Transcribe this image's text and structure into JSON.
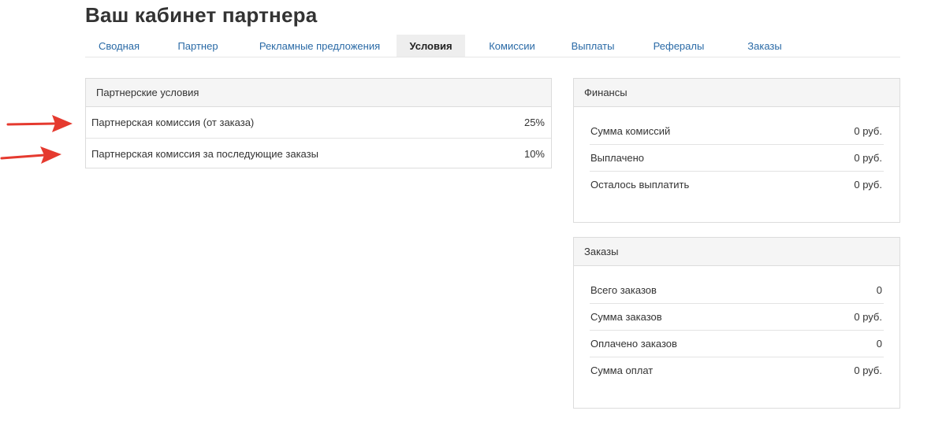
{
  "page": {
    "title": "Ваш кабинет партнера"
  },
  "tabs": [
    {
      "label": "Сводная",
      "active": false
    },
    {
      "label": "Партнер",
      "active": false
    },
    {
      "label": "Рекламные предложения",
      "active": false
    },
    {
      "label": "Условия",
      "active": true
    },
    {
      "label": "Комиссии",
      "active": false
    },
    {
      "label": "Выплаты",
      "active": false
    },
    {
      "label": "Рефералы",
      "active": false
    },
    {
      "label": "Заказы",
      "active": false
    }
  ],
  "conditions": {
    "title": "Партнерские условия",
    "rows": [
      {
        "label": "Партнерская комиссия (от заказа)",
        "value": "25%"
      },
      {
        "label": "Партнерская комиссия за последующие заказы",
        "value": "10%"
      }
    ]
  },
  "finance": {
    "title": "Финансы",
    "rows": [
      {
        "label": "Сумма комиссий",
        "value": "0 руб."
      },
      {
        "label": "Выплачено",
        "value": "0 руб."
      },
      {
        "label": "Осталось выплатить",
        "value": "0 руб."
      }
    ]
  },
  "orders": {
    "title": "Заказы",
    "rows": [
      {
        "label": "Всего заказов",
        "value": "0"
      },
      {
        "label": "Сумма заказов",
        "value": "0 руб."
      },
      {
        "label": "Оплачено заказов",
        "value": "0"
      },
      {
        "label": "Сумма оплат",
        "value": "0 руб."
      }
    ]
  },
  "colors": {
    "link": "#2a6aa6",
    "annotation_arrow": "#e53a2f"
  },
  "icons": [
    "arrow-right-icon"
  ]
}
